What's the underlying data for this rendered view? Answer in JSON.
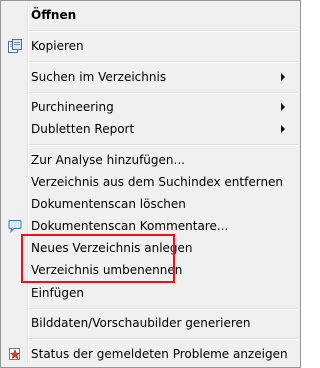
{
  "menu": {
    "open_label": "Öffnen",
    "copy_label": "Kopieren",
    "search_in_dir_label": "Suchen im Verzeichnis",
    "purchineering_label": "Purchineering",
    "duplicates_report_label": "Dubletten Report",
    "add_to_analysis_label": "Zur Analyse hinzufügen...",
    "remove_from_index_label": "Verzeichnis aus dem Suchindex entfernen",
    "delete_docscan_label": "Dokumentenscan löschen",
    "docscan_comments_label": "Dokumentenscan Kommentare...",
    "new_directory_label": "Neues Verzeichnis anlegen",
    "rename_directory_label": "Verzeichnis umbenennen",
    "paste_label": "Einfügen",
    "generate_thumbnails_label": "Bilddaten/Vorschaubilder generieren",
    "show_problem_status_label": "Status der gemeldeten Probleme anzeigen"
  },
  "icons": {
    "copy": "copy-icon",
    "comment": "comment-icon",
    "status": "status-star-icon",
    "submenu": "chevron-right-icon"
  },
  "colors": {
    "menu_background": "#f0f0f0",
    "menu_border": "#979797",
    "highlight_box": "#e8131b"
  }
}
